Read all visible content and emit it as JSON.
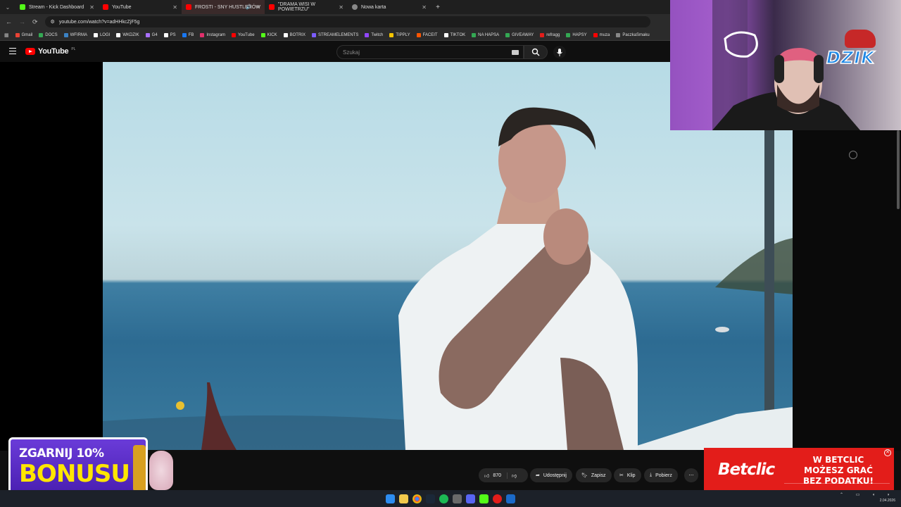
{
  "browser": {
    "tabs": [
      {
        "title": "Stream - Kick Dashboard",
        "favicon": "kick-icon",
        "color": "#53fc18"
      },
      {
        "title": "YouTube",
        "favicon": "youtube-icon",
        "color": "#ff0000"
      },
      {
        "title": "FROSTI - SNY HUSTLERÓW",
        "favicon": "youtube-icon",
        "color": "#ff0000"
      },
      {
        "title": "\"DRAMA WISI W POWIETRZU\"",
        "favicon": "youtube-icon",
        "color": "#ff0000"
      },
      {
        "title": "Nowa karta",
        "favicon": "chrome-icon",
        "color": "#888888"
      }
    ],
    "new_tab": "+",
    "url": "youtube.com/watch?v=adHHkcZjF5g",
    "bookmarks": [
      {
        "label": "Gmail",
        "color": "#ea4335"
      },
      {
        "label": "DOCS",
        "color": "#34a853"
      },
      {
        "label": "WFIRMA",
        "color": "#3b82c4"
      },
      {
        "label": "LOGI",
        "color": "#ffffff"
      },
      {
        "label": "WKDZIK",
        "color": "#ffffff"
      },
      {
        "label": "G4",
        "color": "#a970ff"
      },
      {
        "label": "PS",
        "color": "#ffffff"
      },
      {
        "label": "FB",
        "color": "#1877f2"
      },
      {
        "label": "Instagram",
        "color": "#e1306c"
      },
      {
        "label": "YouTube",
        "color": "#ff0000"
      },
      {
        "label": "KICK",
        "color": "#53fc18"
      },
      {
        "label": "BOTRIX",
        "color": "#ffffff"
      },
      {
        "label": "STREAMELEMENTS",
        "color": "#7b5cff"
      },
      {
        "label": "Twitch",
        "color": "#9146ff"
      },
      {
        "label": "TIPPLY",
        "color": "#f5c400"
      },
      {
        "label": "FACEIT",
        "color": "#ff5500"
      },
      {
        "label": "TIKTOK",
        "color": "#ffffff"
      },
      {
        "label": "NA HAPSA",
        "color": "#34a853"
      },
      {
        "label": "GIVEAWAY",
        "color": "#34a853"
      },
      {
        "label": "refragg",
        "color": "#e31d1a"
      },
      {
        "label": "HAPSY",
        "color": "#34a853"
      },
      {
        "label": "muza",
        "color": "#ff0000"
      },
      {
        "label": "PaczkaSmaku",
        "color": "#888888"
      }
    ]
  },
  "youtube": {
    "logo": "YouTube",
    "region": "PL",
    "search_placeholder": "Szukaj",
    "actions": {
      "likes": "870",
      "share": "Udostępnij",
      "save": "Zapisz",
      "clip": "Klip",
      "download": "Pobierz"
    }
  },
  "overlay": {
    "sponsor_badge": "DZIK",
    "promo_line1": "ZGARNIJ 10%",
    "promo_line2": "BONUSU",
    "betclic_brand": "Betclic",
    "betclic_line1": "W BETCLIC MOŻESZ GRAĆ",
    "betclic_line2": "BEZ PODATKU!"
  },
  "taskbar": {
    "date": "2.04.2026"
  }
}
